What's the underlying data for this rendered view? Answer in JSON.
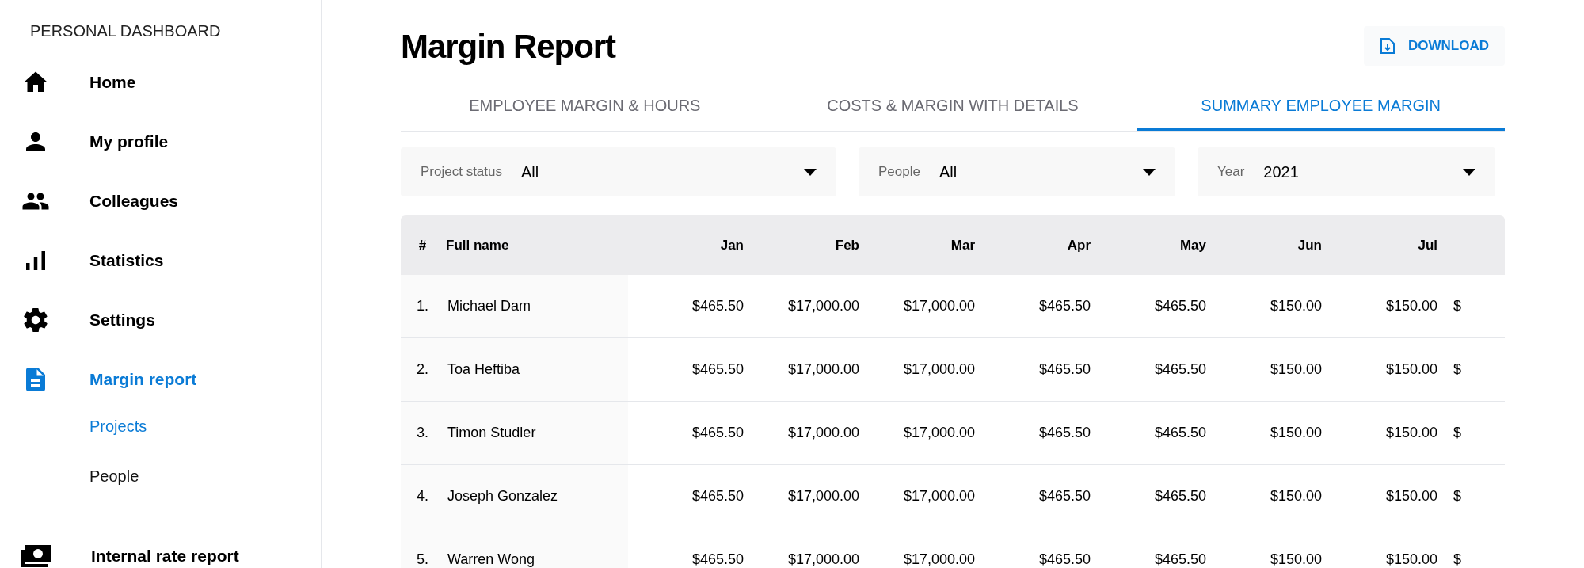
{
  "sidebar": {
    "title": "PERSONAL DASHBOARD",
    "items": [
      {
        "label": "Home",
        "selected": false
      },
      {
        "label": "My profile",
        "selected": false
      },
      {
        "label": "Colleagues",
        "selected": false
      },
      {
        "label": "Statistics",
        "selected": false
      },
      {
        "label": "Settings",
        "selected": false
      },
      {
        "label": "Margin report",
        "selected": true,
        "children": [
          {
            "label": "Projects",
            "selected": true
          },
          {
            "label": "People",
            "selected": false
          }
        ]
      },
      {
        "label": "Internal rate report",
        "selected": false
      }
    ]
  },
  "page": {
    "title": "Margin Report",
    "download_button": "DOWNLOAD"
  },
  "tabs": [
    {
      "label": "EMPLOYEE MARGIN & HOURS",
      "selected": false
    },
    {
      "label": "COSTS & MARGIN WITH DETAILS",
      "selected": false
    },
    {
      "label": "SUMMARY EMPLOYEE MARGIN",
      "selected": true
    }
  ],
  "filters": [
    {
      "label": "Project status",
      "value": "All"
    },
    {
      "label": "People",
      "value": "All"
    },
    {
      "label": "Year",
      "value": "2021"
    }
  ],
  "table": {
    "columns": [
      "#",
      "Full name",
      "Jan",
      "Feb",
      "Mar",
      "Apr",
      "May",
      "Jun",
      "Jul"
    ],
    "rows": [
      {
        "number": "1.",
        "name": "Michael Dam",
        "values": [
          "$465.50",
          "$17,000.00",
          "$17,000.00",
          "$465.50",
          "$465.50",
          "$150.00",
          "$150.00"
        ],
        "column_10": "$"
      },
      {
        "number": "2.",
        "name": "Toa Heftiba",
        "values": [
          "$465.50",
          "$17,000.00",
          "$17,000.00",
          "$465.50",
          "$465.50",
          "$150.00",
          "$150.00"
        ],
        "column_10": "$"
      },
      {
        "number": "3.",
        "name": "Timon Studler",
        "values": [
          "$465.50",
          "$17,000.00",
          "$17,000.00",
          "$465.50",
          "$465.50",
          "$150.00",
          "$150.00"
        ],
        "column_10": "$"
      },
      {
        "number": "4.",
        "name": "Joseph Gonzalez",
        "values": [
          "$465.50",
          "$17,000.00",
          "$17,000.00",
          "$465.50",
          "$465.50",
          "$150.00",
          "$150.00"
        ],
        "column_10": "$"
      },
      {
        "number": "5.",
        "name": "Warren Wong",
        "values": [
          "$465.50",
          "$17,000.00",
          "$17,000.00",
          "$465.50",
          "$465.50",
          "$150.00",
          "$150.00"
        ],
        "column_10": "$"
      }
    ]
  }
}
